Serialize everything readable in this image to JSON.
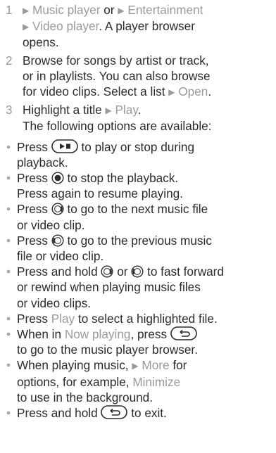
{
  "steps": [
    {
      "num": "1",
      "lines": [
        [
          "Music player",
          " or ",
          "Entertainment"
        ],
        [
          "Video player",
          ". A player browser"
        ],
        [
          "opens."
        ]
      ]
    },
    {
      "num": "2",
      "lines": [
        [
          "Browse for songs by artist or track,"
        ],
        [
          "or in playlists. You can also browse"
        ],
        [
          "for video clips. Select a list ",
          "Open",
          "."
        ]
      ]
    },
    {
      "num": "3",
      "lines": [
        [
          "Highlight a title ",
          "Play",
          "."
        ]
      ]
    }
  ],
  "after_steps": "The following options are available:",
  "bullets": [
    {
      "lines": [
        [
          "Press ",
          " to play or stop during"
        ],
        [
          "playback."
        ]
      ]
    },
    {
      "lines": [
        [
          "Press ",
          " to stop the playback."
        ],
        [
          "Press again to resume playing."
        ]
      ]
    },
    {
      "lines": [
        [
          "Press ",
          " to go to the next music file"
        ],
        [
          "or video clip."
        ]
      ]
    },
    {
      "lines": [
        [
          "Press ",
          " to go to the previous music"
        ],
        [
          "file or video clip."
        ]
      ]
    },
    {
      "lines": [
        [
          "Press and hold ",
          " or ",
          " to fast forward"
        ],
        [
          "or rewind when playing music files"
        ],
        [
          "or video clips."
        ]
      ]
    },
    {
      "lines": [
        [
          "Press ",
          "Play",
          " to select a highlighted file."
        ]
      ]
    },
    {
      "lines": [
        [
          "When in ",
          "Now playing",
          ", press "
        ],
        [
          "to go to the music player browser."
        ]
      ]
    },
    {
      "lines": [
        [
          "When playing music, ",
          "More",
          " for"
        ],
        [
          "options, for example, ",
          "Minimize"
        ],
        [
          "to use in the background."
        ]
      ]
    },
    {
      "lines": [
        [
          "Press and hold ",
          " to exit."
        ]
      ]
    }
  ],
  "icons": {
    "arrow": "right-pointer-icon",
    "play_stop_key": "play-stop-key-icon",
    "center_key": "center-select-key-icon",
    "nav_right_key": "nav-right-key-icon",
    "nav_left_key": "nav-left-key-icon",
    "back_key": "back-key-icon"
  },
  "colors": {
    "text": "#2b2b2b",
    "highlight": "#9a9a9a"
  }
}
